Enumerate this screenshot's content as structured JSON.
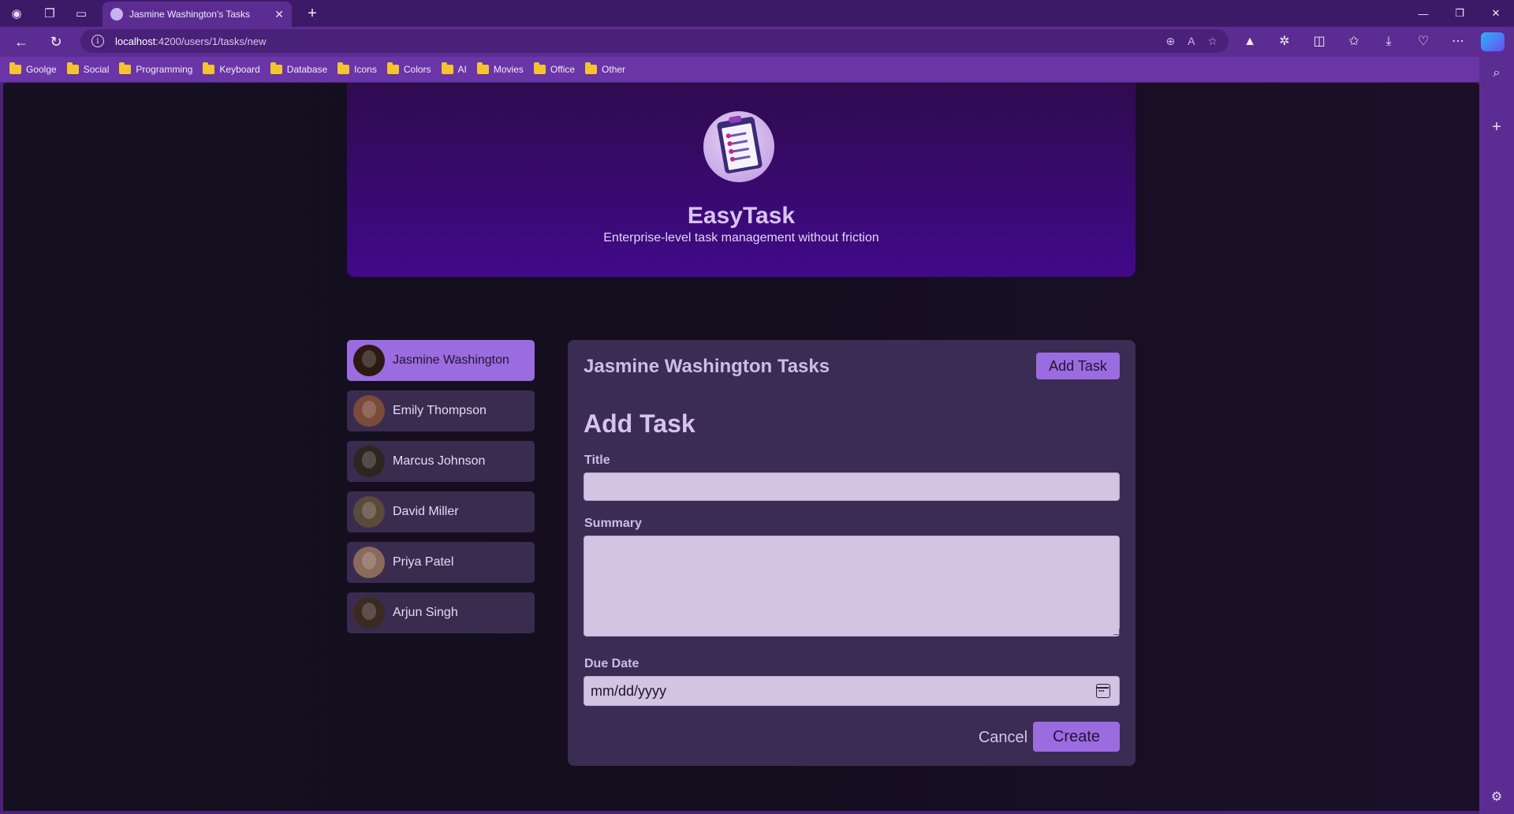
{
  "browser": {
    "tab_title": "Jasmine Washington's Tasks",
    "url_host": "localhost",
    "url_path": ":4200/users/1/tasks/new",
    "bookmarks": [
      "Goolge",
      "Social",
      "Programming",
      "Keyboard",
      "Database",
      "Icons",
      "Colors",
      "AI",
      "Movies",
      "Office",
      "Other"
    ]
  },
  "app": {
    "name": "EasyTask",
    "tagline": "Enterprise-level task management without friction"
  },
  "users": [
    {
      "name": "Jasmine Washington",
      "selected": true,
      "avatar_color": "#2a1a12"
    },
    {
      "name": "Emily Thompson",
      "selected": false,
      "avatar_color": "#7a4a3a"
    },
    {
      "name": "Marcus Johnson",
      "selected": false,
      "avatar_color": "#2e2520"
    },
    {
      "name": "David Miller",
      "selected": false,
      "avatar_color": "#5a4a3a"
    },
    {
      "name": "Priya Patel",
      "selected": false,
      "avatar_color": "#8a6a5a"
    },
    {
      "name": "Arjun Singh",
      "selected": false,
      "avatar_color": "#3a2a22"
    }
  ],
  "tasks_panel": {
    "title": "Jasmine Washington Tasks",
    "add_task_label": "Add Task",
    "form": {
      "heading": "Add Task",
      "title_label": "Title",
      "title_value": "",
      "summary_label": "Summary",
      "summary_value": "",
      "due_date_label": "Due Date",
      "due_date_placeholder": "mm/dd/yyyy",
      "cancel_label": "Cancel",
      "create_label": "Create"
    }
  },
  "colors": {
    "accent": "#9b6be0",
    "panel_bg": "#3a2c52",
    "hero_top": "#2f0b4f",
    "hero_bottom": "#41098a",
    "browser_chrome": "#5b2d92"
  }
}
